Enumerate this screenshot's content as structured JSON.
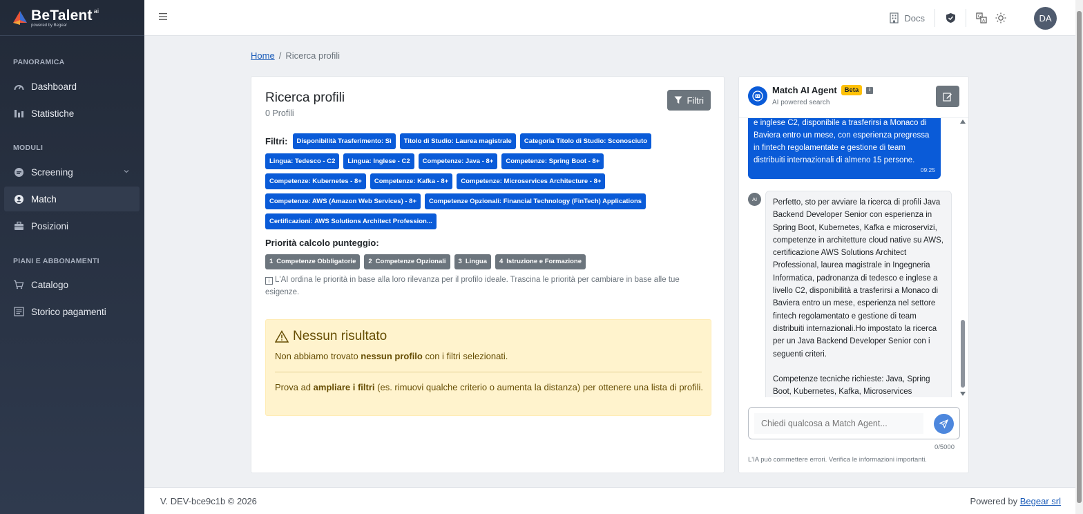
{
  "brand": {
    "name": "BeTalent",
    "ai": "ai",
    "sub": "powered by Begear"
  },
  "sidebar": {
    "sections": [
      "PANORAMICA",
      "MODULI",
      "PIANI E ABBONAMENTI"
    ],
    "items": [
      {
        "label": "Dashboard",
        "icon": "gauge-icon"
      },
      {
        "label": "Statistiche",
        "icon": "bar-chart-icon"
      },
      {
        "label": "Screening",
        "icon": "screening-icon"
      },
      {
        "label": "Match",
        "icon": "user-badge-icon",
        "active": true
      },
      {
        "label": "Posizioni",
        "icon": "briefcase-icon"
      },
      {
        "label": "Catalogo",
        "icon": "cart-icon"
      },
      {
        "label": "Storico pagamenti",
        "icon": "receipt-icon"
      }
    ]
  },
  "header": {
    "docs_label": "Docs",
    "avatar": "DA"
  },
  "breadcrumb": {
    "home": "Home",
    "current": "Ricerca profili"
  },
  "main": {
    "title": "Ricerca profili",
    "count": "0 Profili",
    "filter_button": "Filtri",
    "filters_label": "Filtri:",
    "filter_rows": [
      [
        "Disponibilità Trasferimento: Sì",
        "Titolo di Studio: Laurea magistrale",
        "Categoria Titolo di Studio: Sconosciuto"
      ],
      [
        "Lingua: Tedesco - C2",
        "Lingua: Inglese - C2",
        "Competenze: Java - 8+",
        "Competenze: Spring Boot - 8+"
      ],
      [
        "Competenze: Kubernetes - 8+",
        "Competenze: Kafka - 8+",
        "Competenze: Microservices Architecture - 8+"
      ],
      [
        "Competenze: AWS (Amazon Web Services) - 8+",
        "Competenze Opzionali: Financial Technology (FinTech) Applications"
      ],
      [
        "Certificazioni: AWS Solutions Architect Profession..."
      ]
    ],
    "priority_title": "Priorità calcolo punteggio:",
    "priorities": [
      {
        "n": "1",
        "label": "Competenze Obbligatorie"
      },
      {
        "n": "2",
        "label": "Competenze Opzionali"
      },
      {
        "n": "3",
        "label": "Lingua"
      },
      {
        "n": "4",
        "label": "Istruzione e Formazione"
      }
    ],
    "priority_hint": "L'AI ordina le priorità in base alla loro rilevanza per il profilo ideale. Trascina le priorità per cambiare in base alle tue esigenze.",
    "alert": {
      "title": "Nessun risultato",
      "p1_pre": "Non abbiamo trovato ",
      "p1_bold": "nessun profilo",
      "p1_post": " con i filtri selezionati.",
      "p2_pre": "Prova ad ",
      "p2_bold": "ampliare i filtri",
      "p2_post": " (es. rimuovi qualche criterio o aumenta la distanza) per ottenere una lista di profili."
    }
  },
  "chat": {
    "agent_name": "Match AI Agent",
    "beta": "Beta",
    "agent_sub": "AI powered search",
    "user_message": "e inglese C2, disponibile a trasferirsi a Monaco di Baviera entro un mese, con esperienza pregressa in fintech regolamentate e gestione di team distribuiti internazionali di almeno 15 persone.",
    "user_time": "09:25",
    "ai_badge": "AI",
    "ai_message_1": "Perfetto, sto per avviare la ricerca di profili Java Backend Developer Senior con esperienza in Spring Boot, Kubernetes, Kafka e microservizi, competenze in architetture cloud native su AWS, certificazione AWS Solutions Architect Professional, laurea magistrale in Ingegneria Informatica, padronanza di tedesco e inglese a livello C2, disponibilità a trasferirsi a Monaco di Baviera entro un mese, esperienza nel settore fintech regolamentato e gestione di team distribuiti internazionali.Ho impostato la ricerca per un Java Backend Developer Senior con i seguenti criteri.",
    "ai_message_2": "Competenze tecniche richieste: Java, Spring Boot, Kubernetes, Kafka, Microservices",
    "input_placeholder": "Chiedi qualcosa a Match Agent...",
    "counter": "0/5000",
    "disclaimer": "L'IA può commettere errori. Verifica le informazioni importanti."
  },
  "footer": {
    "version": "V. DEV-bce9c1b © 2026",
    "powered_pre": "Powered by ",
    "powered_link": "Begear srl"
  }
}
